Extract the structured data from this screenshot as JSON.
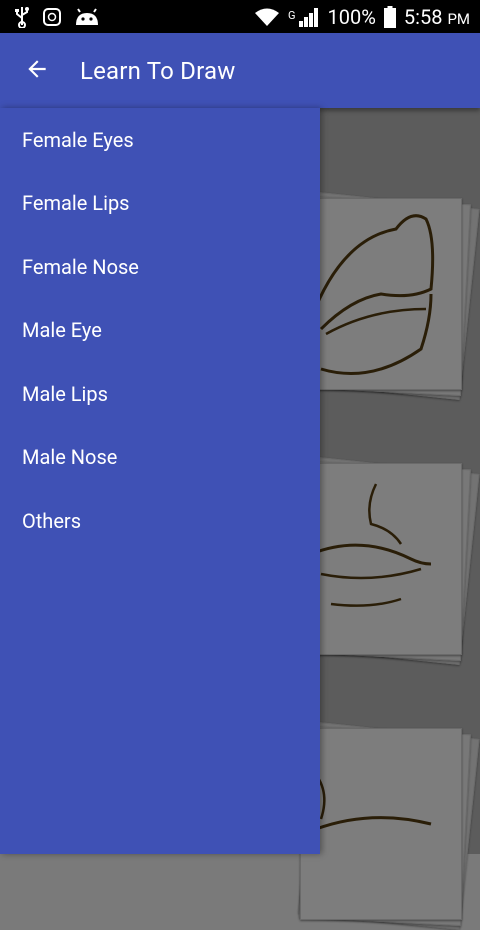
{
  "status_bar": {
    "network_type": "G",
    "battery_percent": "100%",
    "time": "5:58",
    "time_suffix": "PM"
  },
  "toolbar": {
    "title": "Learn To Draw"
  },
  "drawer": {
    "items": [
      {
        "label": "Female Eyes"
      },
      {
        "label": "Female Lips"
      },
      {
        "label": "Female Nose"
      },
      {
        "label": "Male Eye"
      },
      {
        "label": "Male Lips"
      },
      {
        "label": "Male Nose"
      },
      {
        "label": "Others"
      }
    ]
  },
  "colors": {
    "primary": "#3f51b5",
    "status_bar": "#000000",
    "scrim_bg": "#5c5c5c"
  }
}
